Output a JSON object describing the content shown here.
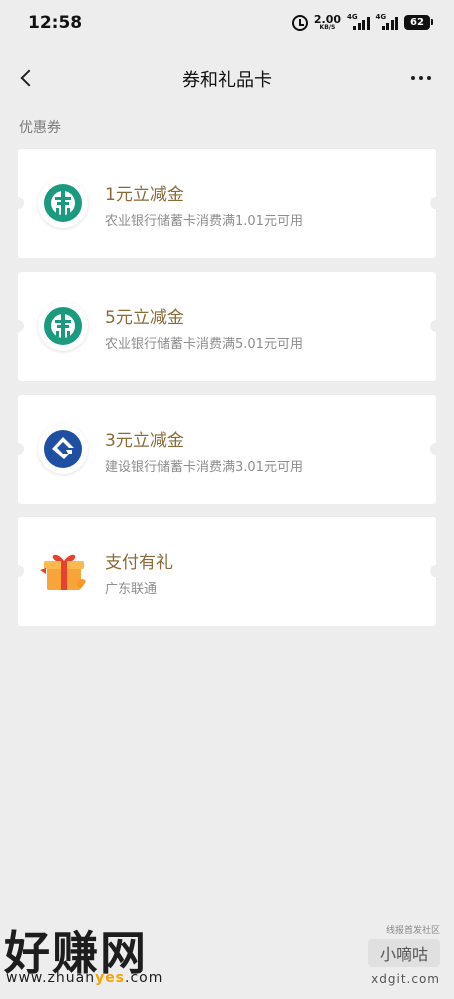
{
  "status_bar": {
    "time": "12:58",
    "net_speed": "2.00",
    "net_unit": "KB/S",
    "sim1": "4G",
    "sim2": "4G",
    "battery": "62"
  },
  "nav": {
    "title": "券和礼品卡",
    "back_icon": "chevron-left-icon",
    "more_icon": "more-horizontal-icon"
  },
  "section_label": "优惠券",
  "coupons": [
    {
      "title": "1元立减金",
      "desc": "农业银行储蓄卡消费满1.01元可用",
      "logo": "abc-bank-logo",
      "logo_color": "#1a9b80"
    },
    {
      "title": "5元立减金",
      "desc": "农业银行储蓄卡消费满5.01元可用",
      "logo": "abc-bank-logo",
      "logo_color": "#1a9b80"
    },
    {
      "title": "3元立减金",
      "desc": "建设银行储蓄卡消费满3.01元可用",
      "logo": "ccb-bank-logo",
      "logo_color": "#1f4fa3"
    },
    {
      "title": "支付有礼",
      "desc": "广东联通",
      "logo": "gift-box-logo",
      "logo_color": "#f39a2b"
    }
  ],
  "watermark": {
    "big_text": "好赚网",
    "url_prefix": "www.zhuan",
    "url_highlight": "yes",
    "url_suffix": ".com",
    "right_top": "线报首发社区",
    "right_badge": "小嘀咕",
    "right_url": "xdgit.com"
  },
  "colors": {
    "background": "#ededed",
    "card_title": "#8a6a36",
    "card_desc": "#8e8e8e"
  }
}
